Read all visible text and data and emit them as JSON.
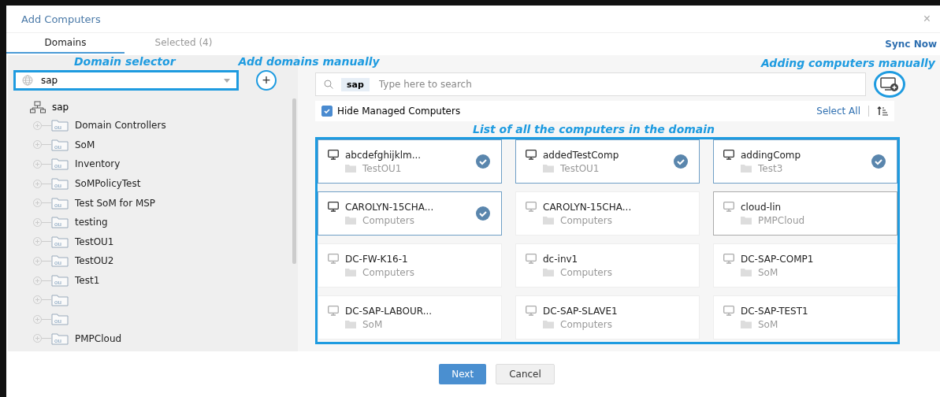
{
  "window": {
    "title": "Add Computers",
    "close": "×"
  },
  "tabs": [
    {
      "label": "Domains",
      "selected": true
    },
    {
      "label": "Selected (4)",
      "selected": false
    }
  ],
  "sync_now": "Sync Now",
  "domain_selector": {
    "annotation": "Domain selector",
    "value": "sap"
  },
  "add_domains": {
    "annotation": "Add domains manually",
    "icon": "+"
  },
  "tree": {
    "label": "sap",
    "children": [
      {
        "kind": "ou",
        "label": "Domain Controllers"
      },
      {
        "kind": "ou",
        "label": "SoM"
      },
      {
        "kind": "ou",
        "label": "Inventory"
      },
      {
        "kind": "ou",
        "label": "SoMPolicyTest"
      },
      {
        "kind": "ou",
        "label": "Test SoM for MSP"
      },
      {
        "kind": "ou",
        "label": "testing"
      },
      {
        "kind": "ou",
        "label": "TestOU1"
      },
      {
        "kind": "ou",
        "label": "TestOU2"
      },
      {
        "kind": "ou",
        "label": "Test1"
      },
      {
        "kind": "ou"
      },
      {
        "kind": "ou"
      },
      {
        "kind": "ou",
        "label": "PMPCloud"
      }
    ]
  },
  "search": {
    "chip": "sap",
    "placeholder": "Type here to search"
  },
  "add_computers": {
    "annotation": "Adding computers manually"
  },
  "hide_managed": {
    "label": "Hide Managed Computers",
    "checked": true
  },
  "select_all": "Select All",
  "list_annotation": "List of all the computers in the domain",
  "computers": [
    {
      "name": "abcdefghijklm...",
      "ou": "TestOU1",
      "selected": true,
      "hovered": false
    },
    {
      "name": "addedTestComp",
      "ou": "TestOU1",
      "selected": true,
      "hovered": false
    },
    {
      "name": "addingComp",
      "ou": "Test3",
      "selected": true,
      "hovered": false
    },
    {
      "name": "CAROLYN-15CHA...",
      "ou": "Computers",
      "selected": true,
      "hovered": false
    },
    {
      "name": "CAROLYN-15CHA...",
      "ou": "Computers",
      "selected": false,
      "hovered": false
    },
    {
      "name": "cloud-lin",
      "ou": "PMPCloud",
      "selected": false,
      "hovered": true
    },
    {
      "name": "DC-FW-K16-1",
      "ou": "Computers",
      "selected": false,
      "hovered": false
    },
    {
      "name": "dc-inv1",
      "ou": "Computers",
      "selected": false,
      "hovered": false
    },
    {
      "name": "DC-SAP-COMP1",
      "ou": "SoM",
      "selected": false,
      "hovered": false
    },
    {
      "name": "DC-SAP-LABOUR...",
      "ou": "SoM",
      "selected": false,
      "hovered": false
    },
    {
      "name": "DC-SAP-SLAVE1",
      "ou": "Computers",
      "selected": false,
      "hovered": false
    },
    {
      "name": "DC-SAP-TEST1",
      "ou": "SoM",
      "selected": false,
      "hovered": false
    }
  ],
  "buttons": [
    {
      "label": "Next",
      "kind": "primary"
    },
    {
      "label": "Cancel",
      "kind": "secondary"
    }
  ]
}
